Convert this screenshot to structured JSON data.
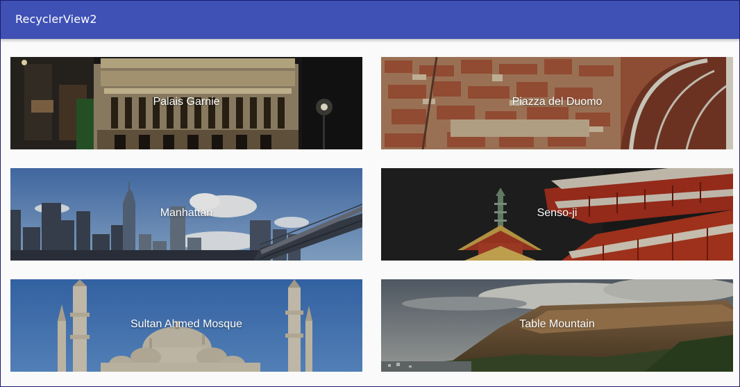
{
  "app": {
    "title": "RecyclerView2",
    "accent_color": "#3f51b5"
  },
  "cards": [
    {
      "label": "Palais Garnie"
    },
    {
      "label": "Piazza del Duomo"
    },
    {
      "label": "Manhattan"
    },
    {
      "label": "Senso-ji"
    },
    {
      "label": "Sultan Ahmed Mosque"
    },
    {
      "label": "Table Mountain"
    }
  ]
}
